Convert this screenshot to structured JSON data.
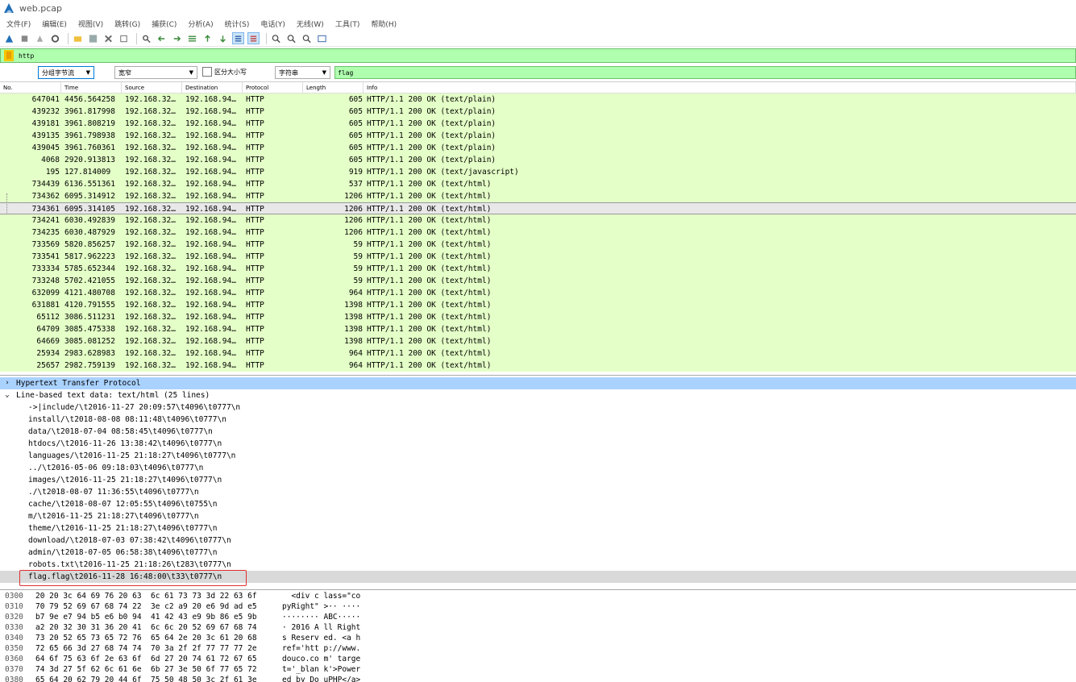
{
  "window": {
    "title": "web.pcap"
  },
  "menu": [
    "文件(F)",
    "编辑(E)",
    "视图(V)",
    "跳转(G)",
    "捕获(C)",
    "分析(A)",
    "统计(S)",
    "电话(Y)",
    "无线(W)",
    "工具(T)",
    "帮助(H)"
  ],
  "toolbar_icons": [
    "shark-fin-icon",
    "stop-icon",
    "restart-icon",
    "options-icon",
    "open-folder-icon",
    "save-icon",
    "close-file-icon",
    "reload-icon",
    "find-icon",
    "go-back-icon",
    "go-forward-icon",
    "go-to-packet-icon",
    "first-packet-icon",
    "last-packet-icon",
    "autoscroll-icon",
    "colorize-icon",
    "zoom-in-icon",
    "zoom-out-icon",
    "zoom-normal-icon",
    "resize-columns-icon"
  ],
  "display_filter": {
    "value": "http"
  },
  "search": {
    "scope": "分组字节流",
    "charset": "宽窄",
    "case_label": "区分大小写",
    "type": "字符串",
    "value": "flag"
  },
  "packet_list": {
    "columns": [
      "No.",
      "Time",
      "Source",
      "Destination",
      "Protocol",
      "Length",
      "Info"
    ],
    "rows": [
      {
        "no": "647041",
        "time": "4456.564258",
        "src": "192.168.32…",
        "dst": "192.168.94…",
        "proto": "HTTP",
        "len": "605",
        "info": "HTTP/1.1 200 OK  (text/plain)"
      },
      {
        "no": "439232",
        "time": "3961.817998",
        "src": "192.168.32…",
        "dst": "192.168.94…",
        "proto": "HTTP",
        "len": "605",
        "info": "HTTP/1.1 200 OK  (text/plain)"
      },
      {
        "no": "439181",
        "time": "3961.808219",
        "src": "192.168.32…",
        "dst": "192.168.94…",
        "proto": "HTTP",
        "len": "605",
        "info": "HTTP/1.1 200 OK  (text/plain)"
      },
      {
        "no": "439135",
        "time": "3961.798938",
        "src": "192.168.32…",
        "dst": "192.168.94…",
        "proto": "HTTP",
        "len": "605",
        "info": "HTTP/1.1 200 OK  (text/plain)"
      },
      {
        "no": "439045",
        "time": "3961.760361",
        "src": "192.168.32…",
        "dst": "192.168.94…",
        "proto": "HTTP",
        "len": "605",
        "info": "HTTP/1.1 200 OK  (text/plain)"
      },
      {
        "no": "4068",
        "time": "2920.913813",
        "src": "192.168.32…",
        "dst": "192.168.94…",
        "proto": "HTTP",
        "len": "605",
        "info": "HTTP/1.1 200 OK  (text/plain)"
      },
      {
        "no": "195",
        "time": "127.814009",
        "src": "192.168.32…",
        "dst": "192.168.94…",
        "proto": "HTTP",
        "len": "919",
        "info": "HTTP/1.1 200 OK  (text/javascript)"
      },
      {
        "no": "734439",
        "time": "6136.551361",
        "src": "192.168.32…",
        "dst": "192.168.94…",
        "proto": "HTTP",
        "len": "537",
        "info": "HTTP/1.1 200 OK  (text/html)"
      },
      {
        "no": "734362",
        "time": "6095.314912",
        "src": "192.168.32…",
        "dst": "192.168.94…",
        "proto": "HTTP",
        "len": "1206",
        "info": "HTTP/1.1 200 OK  (text/html)"
      },
      {
        "no": "734361",
        "time": "6095.314105",
        "src": "192.168.32…",
        "dst": "192.168.94…",
        "proto": "HTTP",
        "len": "1206",
        "info": "HTTP/1.1 200 OK  (text/html)",
        "selected": true
      },
      {
        "no": "734241",
        "time": "6030.492839",
        "src": "192.168.32…",
        "dst": "192.168.94…",
        "proto": "HTTP",
        "len": "1206",
        "info": "HTTP/1.1 200 OK  (text/html)"
      },
      {
        "no": "734235",
        "time": "6030.487929",
        "src": "192.168.32…",
        "dst": "192.168.94…",
        "proto": "HTTP",
        "len": "1206",
        "info": "HTTP/1.1 200 OK  (text/html)"
      },
      {
        "no": "733569",
        "time": "5820.856257",
        "src": "192.168.32…",
        "dst": "192.168.94…",
        "proto": "HTTP",
        "len": "59",
        "info": "HTTP/1.1 200 OK  (text/html)"
      },
      {
        "no": "733541",
        "time": "5817.962223",
        "src": "192.168.32…",
        "dst": "192.168.94…",
        "proto": "HTTP",
        "len": "59",
        "info": "HTTP/1.1 200 OK  (text/html)"
      },
      {
        "no": "733334",
        "time": "5785.652344",
        "src": "192.168.32…",
        "dst": "192.168.94…",
        "proto": "HTTP",
        "len": "59",
        "info": "HTTP/1.1 200 OK  (text/html)"
      },
      {
        "no": "733248",
        "time": "5702.421055",
        "src": "192.168.32…",
        "dst": "192.168.94…",
        "proto": "HTTP",
        "len": "59",
        "info": "HTTP/1.1 200 OK  (text/html)"
      },
      {
        "no": "632099",
        "time": "4121.480708",
        "src": "192.168.32…",
        "dst": "192.168.94…",
        "proto": "HTTP",
        "len": "964",
        "info": "HTTP/1.1 200 OK  (text/html)"
      },
      {
        "no": "631881",
        "time": "4120.791555",
        "src": "192.168.32…",
        "dst": "192.168.94…",
        "proto": "HTTP",
        "len": "1398",
        "info": "HTTP/1.1 200 OK  (text/html)"
      },
      {
        "no": "65112",
        "time": "3086.511231",
        "src": "192.168.32…",
        "dst": "192.168.94…",
        "proto": "HTTP",
        "len": "1398",
        "info": "HTTP/1.1 200 OK  (text/html)"
      },
      {
        "no": "64709",
        "time": "3085.475338",
        "src": "192.168.32…",
        "dst": "192.168.94…",
        "proto": "HTTP",
        "len": "1398",
        "info": "HTTP/1.1 200 OK  (text/html)"
      },
      {
        "no": "64669",
        "time": "3085.081252",
        "src": "192.168.32…",
        "dst": "192.168.94…",
        "proto": "HTTP",
        "len": "1398",
        "info": "HTTP/1.1 200 OK  (text/html)"
      },
      {
        "no": "25934",
        "time": "2983.628983",
        "src": "192.168.32…",
        "dst": "192.168.94…",
        "proto": "HTTP",
        "len": "964",
        "info": "HTTP/1.1 200 OK  (text/html)"
      },
      {
        "no": "25657",
        "time": "2982.759139",
        "src": "192.168.32…",
        "dst": "192.168.94…",
        "proto": "HTTP",
        "len": "964",
        "info": "HTTP/1.1 200 OK  (text/html)"
      }
    ]
  },
  "details": {
    "tree": [
      {
        "arrow": "›",
        "text": "Hypertext Transfer Protocol",
        "level": 0,
        "highlight": true
      },
      {
        "arrow": "⌄",
        "text": "Line-based text data: text/html (25 lines)",
        "level": 0
      },
      {
        "text": "->|include/\\t2016-11-27 20:09:57\\t4096\\t0777\\n",
        "level": 1
      },
      {
        "text": "install/\\t2018-08-08 08:11:48\\t4096\\t0777\\n",
        "level": 1
      },
      {
        "text": "data/\\t2018-07-04 08:58:45\\t4096\\t0777\\n",
        "level": 1
      },
      {
        "text": "htdocs/\\t2016-11-26 13:38:42\\t4096\\t0777\\n",
        "level": 1
      },
      {
        "text": "languages/\\t2016-11-25 21:18:27\\t4096\\t0777\\n",
        "level": 1
      },
      {
        "text": "../\\t2016-05-06 09:18:03\\t4096\\t0777\\n",
        "level": 1
      },
      {
        "text": "images/\\t2016-11-25 21:18:27\\t4096\\t0777\\n",
        "level": 1
      },
      {
        "text": "./\\t2018-08-07 11:36:55\\t4096\\t0777\\n",
        "level": 1
      },
      {
        "text": "cache/\\t2018-08-07 12:05:55\\t4096\\t0755\\n",
        "level": 1
      },
      {
        "text": "m/\\t2016-11-25 21:18:27\\t4096\\t0777\\n",
        "level": 1
      },
      {
        "text": "theme/\\t2016-11-25 21:18:27\\t4096\\t0777\\n",
        "level": 1
      },
      {
        "text": "download/\\t2018-07-03 07:38:42\\t4096\\t0777\\n",
        "level": 1
      },
      {
        "text": "admin/\\t2018-07-05 06:58:38\\t4096\\t0777\\n",
        "level": 1
      },
      {
        "text": "robots.txt\\t2016-11-25 21:18:26\\t283\\t0777\\n",
        "level": 1
      },
      {
        "text": "flag.flag\\t2016-11-28 16:48:00\\t33\\t0777\\n",
        "level": 1,
        "selected": true
      }
    ]
  },
  "hex": [
    {
      "offset": "0300",
      "bytes": "20 20 3c 64 69 76 20 63  6c 61 73 73 3d 22 63 6f",
      "ascii": "  <div c lass=\"co"
    },
    {
      "offset": "0310",
      "bytes": "70 79 52 69 67 68 74 22  3e c2 a9 20 e6 9d ad e5",
      "ascii": "pyRight\" >·· ····"
    },
    {
      "offset": "0320",
      "bytes": "b7 9e e7 94 b5 e6 b0 94  41 42 43 e9 9b 86 e5 9b",
      "ascii": "········ ABC·····"
    },
    {
      "offset": "0330",
      "bytes": "a2 20 32 30 31 36 20 41  6c 6c 20 52 69 67 68 74",
      "ascii": "· 2016 A ll Right"
    },
    {
      "offset": "0340",
      "bytes": "73 20 52 65 73 65 72 76  65 64 2e 20 3c 61 20 68",
      "ascii": "s Reserv ed. <a h"
    },
    {
      "offset": "0350",
      "bytes": "72 65 66 3d 27 68 74 74  70 3a 2f 2f 77 77 77 2e",
      "ascii": "ref='htt p://www."
    },
    {
      "offset": "0360",
      "bytes": "64 6f 75 63 6f 2e 63 6f  6d 27 20 74 61 72 67 65",
      "ascii": "douco.co m' targe"
    },
    {
      "offset": "0370",
      "bytes": "74 3d 27 5f 62 6c 61 6e  6b 27 3e 50 6f 77 65 72",
      "ascii": "t='_blan k'>Power"
    },
    {
      "offset": "0380",
      "bytes": "65 64 20 62 79 20 44 6f  75 50 48 50 3c 2f 61 3e",
      "ascii": "ed by Do uPHP</a>"
    }
  ],
  "colors": {
    "http_row_bg": "#e4ffc7",
    "filter_valid_bg": "#afffaf",
    "highlight_blue": "#aad2ff",
    "annotation_red": "#e03030"
  }
}
